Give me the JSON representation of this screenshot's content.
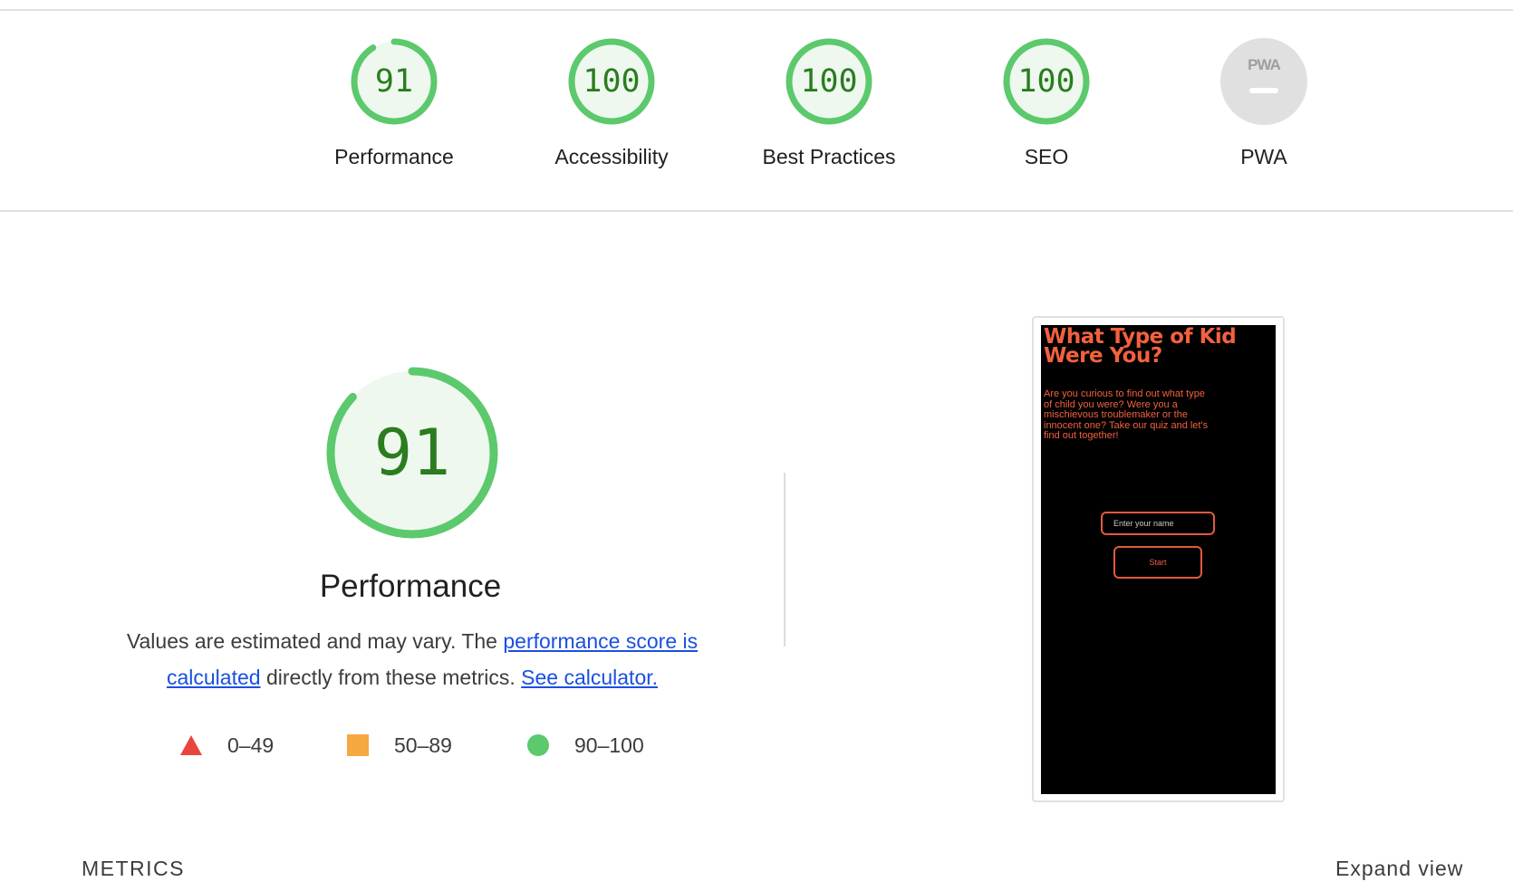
{
  "colors": {
    "pass_green": "#5bc96c",
    "pass_green_text": "#2b7c1f",
    "pass_green_fill": "#eef8ef",
    "average_orange": "#f5a742",
    "fail_red": "#e8453c",
    "na_gray": "#e0e0e0",
    "link_blue": "#1a4fe0"
  },
  "scores": [
    {
      "label": "Performance",
      "value": "91",
      "fraction": 0.91
    },
    {
      "label": "Accessibility",
      "value": "100",
      "fraction": 1.0
    },
    {
      "label": "Best Practices",
      "value": "100",
      "fraction": 1.0
    },
    {
      "label": "SEO",
      "value": "100",
      "fraction": 1.0
    }
  ],
  "pwa": {
    "label": "PWA",
    "badge_text": "PWA",
    "icon": "pwa-na-icon"
  },
  "performance": {
    "score": "91",
    "fraction": 0.91,
    "title": "Performance",
    "desc_prefix": "Values are estimated and may vary. The ",
    "desc_link1": "performance score is calculated",
    "desc_middle": " directly from these metrics. ",
    "desc_link2": "See calculator."
  },
  "legend": [
    {
      "range": "0–49",
      "icon": "red-triangle-icon"
    },
    {
      "range": "50–89",
      "icon": "orange-square-icon"
    },
    {
      "range": "90–100",
      "icon": "green-circle-icon"
    }
  ],
  "screenshot": {
    "title": "What Type of Kid Were You?",
    "body": "Are you curious to find out what type of child you were? Were you a mischievous troublemaker or the innocent one? Take our quiz and let's find out together!",
    "input_placeholder": "Enter your name",
    "button_label": "Start"
  },
  "metrics": {
    "label": "METRICS",
    "expand_label": "Expand view"
  }
}
